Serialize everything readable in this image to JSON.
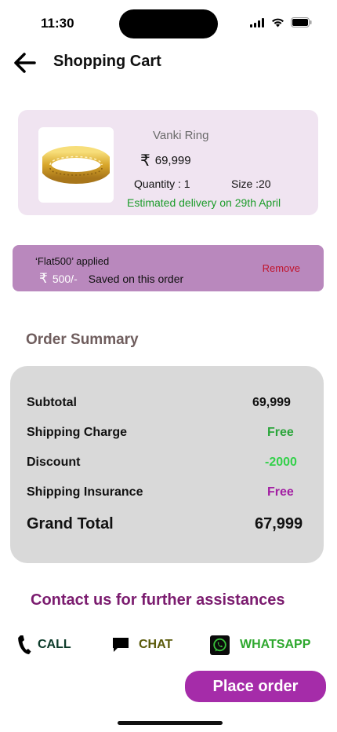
{
  "status_bar": {
    "time": "11:30"
  },
  "header": {
    "title": "Shopping Cart",
    "back_icon": "arrow-left-icon"
  },
  "product": {
    "name": "Vanki Ring",
    "currency_symbol": "₹",
    "price": "69,999",
    "quantity": "Quantity : 1",
    "size": "Size  :20",
    "delivery": "Estimated delivery on 29th April",
    "image_icon": "gold-bracelet-image"
  },
  "coupon": {
    "applied_text": "‘Flat500’ applied",
    "currency_symbol": "₹",
    "amount": "500/-",
    "saved_text": "Saved on this order",
    "remove_label": "Remove",
    "remove_color": "#c0132b"
  },
  "summary": {
    "title": "Order Summary",
    "rows": [
      {
        "label": "Subtotal",
        "value": "69,999",
        "color": "#111111"
      },
      {
        "label": "Shipping Charge",
        "value": "Free",
        "color": "#2aa63a"
      },
      {
        "label": "Discount",
        "value": "-2000",
        "color": "#33d14a"
      },
      {
        "label": "Shipping Insurance",
        "value": "Free",
        "color": "#a31ea3"
      }
    ],
    "grand_total_label": "Grand Total",
    "grand_total_value": "67,999"
  },
  "contact": {
    "title": "Contact us for further assistances",
    "options": [
      {
        "label": "CALL",
        "icon": "phone-icon",
        "color": "#0d3b2a"
      },
      {
        "label": "CHAT",
        "icon": "chat-icon",
        "color": "#5a5a0a"
      },
      {
        "label": "WHATSAPP",
        "icon": "whatsapp-icon",
        "color": "#2fa82f"
      }
    ]
  },
  "actions": {
    "place_order": "Place order",
    "place_order_color": "#a52ca9"
  },
  "colors": {
    "product_card_bg": "#f0e4f1",
    "coupon_bg": "#b988bd",
    "summary_bg": "#d9d9d9",
    "contact_title": "#7b1c6f"
  }
}
